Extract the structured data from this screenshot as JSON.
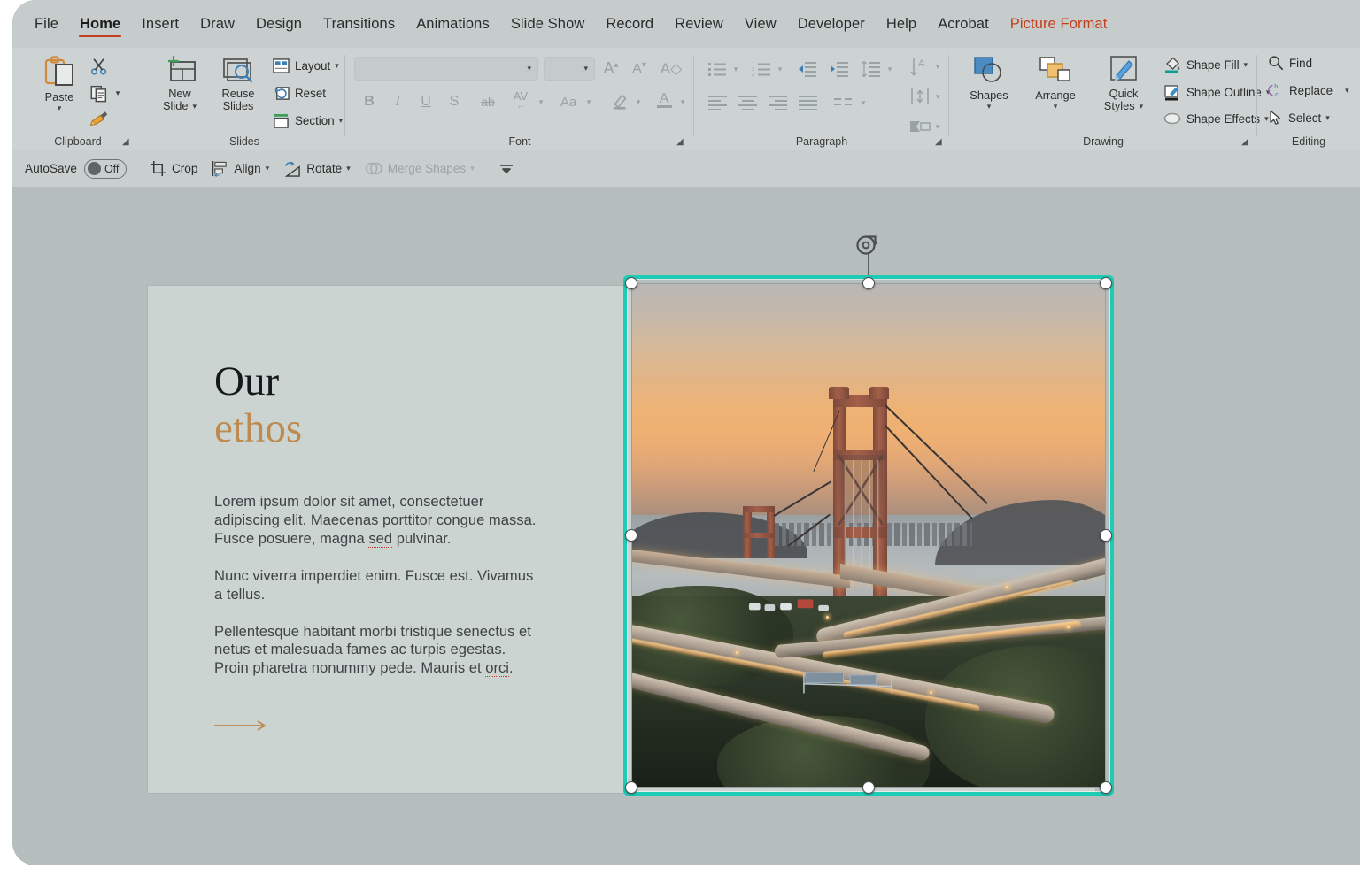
{
  "app": {
    "name": "PowerPoint",
    "selection_color": "#1ecbb4",
    "accent_color": "#c43e1c"
  },
  "menubar": {
    "items": [
      {
        "label": "File",
        "state": "normal"
      },
      {
        "label": "Home",
        "state": "active"
      },
      {
        "label": "Insert",
        "state": "normal"
      },
      {
        "label": "Draw",
        "state": "normal"
      },
      {
        "label": "Design",
        "state": "normal"
      },
      {
        "label": "Transitions",
        "state": "normal"
      },
      {
        "label": "Animations",
        "state": "normal"
      },
      {
        "label": "Slide Show",
        "state": "normal"
      },
      {
        "label": "Record",
        "state": "normal"
      },
      {
        "label": "Review",
        "state": "normal"
      },
      {
        "label": "View",
        "state": "normal"
      },
      {
        "label": "Developer",
        "state": "normal"
      },
      {
        "label": "Help",
        "state": "normal"
      },
      {
        "label": "Acrobat",
        "state": "normal"
      },
      {
        "label": "Picture Format",
        "state": "contextual"
      }
    ]
  },
  "ribbon": {
    "groups": [
      {
        "name": "Clipboard",
        "label": "Clipboard",
        "has_dialog_launcher": true
      },
      {
        "name": "Slides",
        "label": "Slides",
        "has_dialog_launcher": false
      },
      {
        "name": "Font",
        "label": "Font",
        "has_dialog_launcher": true
      },
      {
        "name": "Paragraph",
        "label": "Paragraph",
        "has_dialog_launcher": true
      },
      {
        "name": "Drawing",
        "label": "Drawing",
        "has_dialog_launcher": true
      },
      {
        "name": "Editing",
        "label": "Editing",
        "has_dialog_launcher": false
      }
    ],
    "clipboard": {
      "paste": {
        "label": "Paste",
        "icon": "paste-icon",
        "has_dropdown": true
      },
      "cut": {
        "label": "Cut",
        "icon": "scissors-icon"
      },
      "copy": {
        "label": "Copy",
        "icon": "copy-icon",
        "has_dropdown": true
      },
      "format_painter": {
        "label": "Format Painter",
        "icon": "format-painter-icon"
      }
    },
    "slides": {
      "new_slide": {
        "label": "New Slide",
        "icon": "new-slide-icon",
        "has_dropdown": true
      },
      "reuse_slides": {
        "label": "Reuse Slides",
        "icon": "reuse-slides-icon"
      },
      "layout": {
        "label": "Layout",
        "icon": "layout-icon",
        "has_dropdown": true
      },
      "reset": {
        "label": "Reset",
        "icon": "reset-icon"
      },
      "section": {
        "label": "Section",
        "icon": "section-icon",
        "has_dropdown": true
      }
    },
    "font": {
      "font_name": {
        "value": "",
        "placeholder": "",
        "disabled": true
      },
      "font_size": {
        "value": "",
        "placeholder": "",
        "disabled": true
      },
      "grow_font": {
        "label": "Increase Font Size",
        "icon": "grow-font-icon",
        "disabled": true
      },
      "shrink_font": {
        "label": "Decrease Font Size",
        "icon": "shrink-font-icon",
        "disabled": true
      },
      "clear_formatting": {
        "label": "Clear All Formatting",
        "icon": "clear-formatting-icon",
        "disabled": true
      },
      "bold": {
        "label": "B",
        "icon": "bold-icon",
        "disabled": true
      },
      "italic": {
        "label": "I",
        "icon": "italic-icon",
        "disabled": true
      },
      "underline": {
        "label": "U",
        "icon": "underline-icon",
        "disabled": true
      },
      "shadow": {
        "label": "S",
        "icon": "text-shadow-icon",
        "disabled": true
      },
      "strikethrough": {
        "label": "ab",
        "icon": "strikethrough-icon",
        "disabled": true
      },
      "char_spacing": {
        "label": "AV",
        "icon": "character-spacing-icon",
        "disabled": true,
        "has_dropdown": true
      },
      "change_case": {
        "label": "Aa",
        "icon": "change-case-icon",
        "disabled": true,
        "has_dropdown": true
      },
      "text_highlight": {
        "label": "Text Highlight Color",
        "icon": "highlighter-icon",
        "disabled": true,
        "has_dropdown": true
      },
      "font_color": {
        "label": "A",
        "icon": "font-color-icon",
        "disabled": true,
        "has_dropdown": true
      }
    },
    "paragraph": {
      "bullets": {
        "label": "Bullets",
        "icon": "bullets-icon",
        "disabled": true,
        "has_dropdown": true
      },
      "numbering": {
        "label": "Numbering",
        "icon": "numbering-icon",
        "disabled": true,
        "has_dropdown": true
      },
      "decrease_indent": {
        "label": "Decrease Indent",
        "icon": "decrease-indent-icon",
        "disabled": true
      },
      "increase_indent": {
        "label": "Increase Indent",
        "icon": "increase-indent-icon",
        "disabled": true
      },
      "line_spacing": {
        "label": "Line Spacing",
        "icon": "line-spacing-icon",
        "disabled": true,
        "has_dropdown": true
      },
      "align_left": {
        "label": "Align Left",
        "icon": "align-left-icon",
        "disabled": true
      },
      "align_center": {
        "label": "Center",
        "icon": "align-center-icon",
        "disabled": true
      },
      "align_right": {
        "label": "Align Right",
        "icon": "align-right-icon",
        "disabled": true
      },
      "justify": {
        "label": "Justify",
        "icon": "justify-icon",
        "disabled": true
      },
      "columns": {
        "label": "Columns",
        "icon": "columns-icon",
        "disabled": true,
        "has_dropdown": true
      },
      "text_direction": {
        "label": "Text Direction",
        "icon": "text-direction-icon",
        "disabled": true,
        "has_dropdown": true
      },
      "align_text": {
        "label": "Align Text",
        "icon": "align-text-icon",
        "disabled": true,
        "has_dropdown": true
      },
      "smartart": {
        "label": "Convert to SmartArt",
        "icon": "smartart-icon",
        "disabled": true,
        "has_dropdown": true
      }
    },
    "drawing": {
      "shapes": {
        "label": "Shapes",
        "icon": "shapes-icon",
        "has_dropdown": true
      },
      "arrange": {
        "label": "Arrange",
        "icon": "arrange-icon",
        "has_dropdown": true
      },
      "quick_styles": {
        "label": "Quick Styles",
        "icon": "quick-styles-icon",
        "has_dropdown": true
      },
      "shape_fill": {
        "label": "Shape Fill",
        "icon": "shape-fill-icon",
        "has_dropdown": true,
        "swatch": "#0e9e8f"
      },
      "shape_outline": {
        "label": "Shape Outline",
        "icon": "shape-outline-icon",
        "has_dropdown": true,
        "swatch": "#1b1b1b"
      },
      "shape_effects": {
        "label": "Shape Effects",
        "icon": "shape-effects-icon",
        "has_dropdown": true
      }
    },
    "editing": {
      "find": {
        "label": "Find",
        "icon": "search-icon"
      },
      "replace": {
        "label": "Replace",
        "icon": "replace-icon",
        "has_dropdown": true
      },
      "select": {
        "label": "Select",
        "icon": "select-cursor-icon",
        "has_dropdown": true
      }
    }
  },
  "toolbar2": {
    "autosave": {
      "label": "AutoSave",
      "state_label": "Off",
      "on": false
    },
    "items": [
      {
        "label": "Crop",
        "icon": "crop-icon",
        "has_dropdown": false,
        "disabled": false
      },
      {
        "label": "Align",
        "icon": "align-objects-icon",
        "has_dropdown": true,
        "disabled": false
      },
      {
        "label": "Rotate",
        "icon": "rotate-icon",
        "has_dropdown": true,
        "disabled": false
      },
      {
        "label": "Merge Shapes",
        "icon": "merge-shapes-icon",
        "has_dropdown": true,
        "disabled": true
      }
    ],
    "overflow": {
      "label": "More commands",
      "icon": "double-chevron-down-icon"
    }
  },
  "slide": {
    "background_color": "#ccd4d2",
    "title": {
      "line1": "Our",
      "line2": "ethos",
      "line2_color": "#bd8a4f"
    },
    "body": [
      {
        "id": "p1",
        "segments": [
          {
            "text": "Lorem ipsum dolor sit amet, consectetuer adipiscing elit. Maecenas porttitor congue massa. Fusce posuere, magna ",
            "misspelled": false
          },
          {
            "text": "sed",
            "misspelled": true
          },
          {
            "text": " pulvinar.",
            "misspelled": false
          }
        ]
      },
      {
        "id": "p2",
        "segments": [
          {
            "text": "Nunc viverra imperdiet enim. Fusce est. Vivamus a tellus.",
            "misspelled": false
          }
        ]
      },
      {
        "id": "p3",
        "segments": [
          {
            "text": "Pellentesque habitant morbi tristique senectus et netus et malesuada fames ac turpis egestas. Proin pharetra nonummy pede. Mauris et ",
            "misspelled": false
          },
          {
            "text": "orci",
            "misspelled": true
          },
          {
            "text": ".",
            "misspelled": false
          }
        ]
      }
    ],
    "arrow": {
      "name": "right-arrow-shape",
      "color": "#bd8a4f"
    },
    "picture": {
      "alt": "Suspension bridge at sunset over water with highway interchange and light trails",
      "selected": true,
      "handles": [
        "top-left",
        "top-center",
        "top-right",
        "middle-left",
        "middle-right",
        "bottom-left",
        "bottom-center",
        "bottom-right"
      ],
      "rotate_handle": "rotate-handle"
    }
  }
}
